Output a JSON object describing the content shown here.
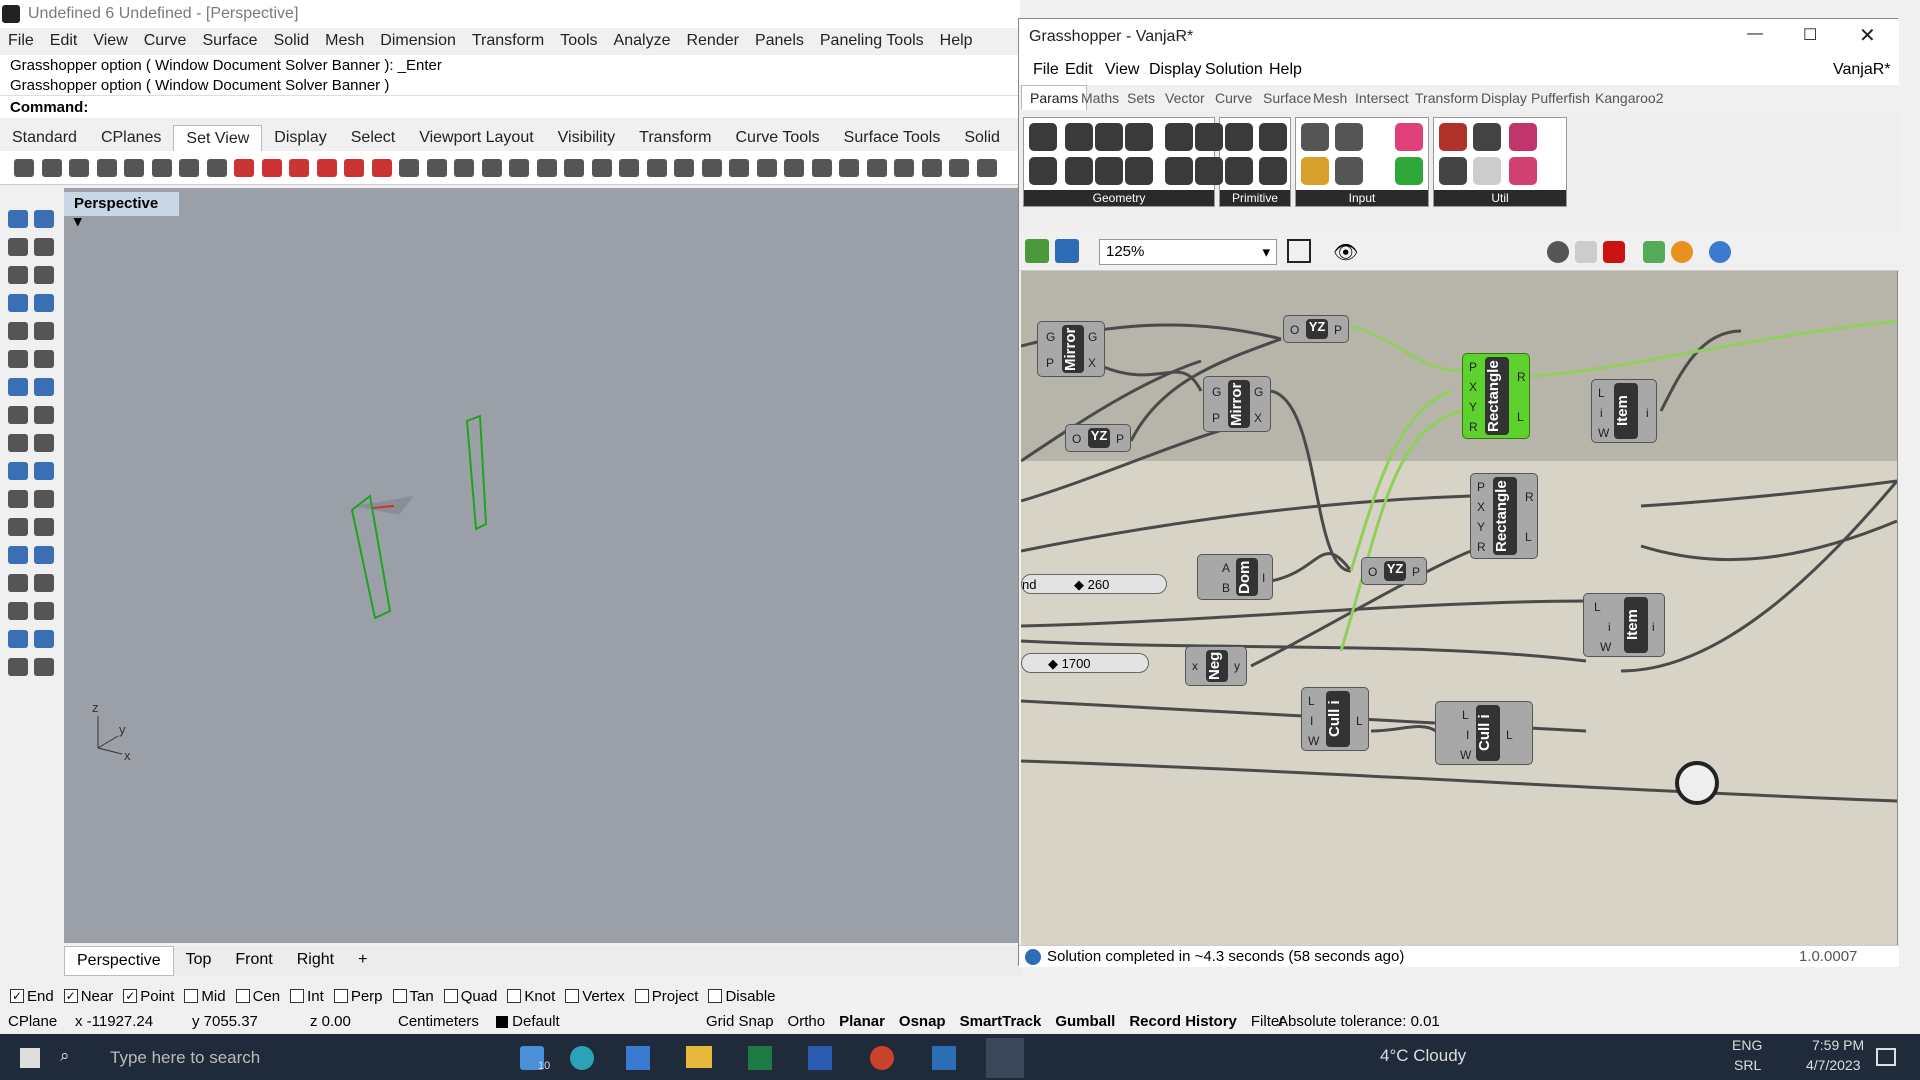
{
  "rhino": {
    "title": "Undefined 6 Undefined - [Perspective]",
    "menu": [
      "File",
      "Edit",
      "View",
      "Curve",
      "Surface",
      "Solid",
      "Mesh",
      "Dimension",
      "Transform",
      "Tools",
      "Analyze",
      "Render",
      "Panels",
      "Paneling Tools",
      "Help"
    ],
    "cmd_history": [
      "Grasshopper option ( Window  Document  Solver  Banner ): _Enter",
      "Grasshopper option ( Window  Document  Solver  Banner )"
    ],
    "command_label": "Command:",
    "tabs": [
      "Standard",
      "CPlanes",
      "Set View",
      "Display",
      "Select",
      "Viewport Layout",
      "Visibility",
      "Transform",
      "Curve Tools",
      "Surface Tools",
      "Solid"
    ],
    "active_tab": "Set View",
    "viewport_label": "Perspective",
    "viewport_tabs": [
      "Perspective",
      "Top",
      "Front",
      "Right"
    ],
    "axes": {
      "z": "z",
      "y": "y",
      "x": "x"
    },
    "osnap": [
      {
        "label": "End",
        "checked": true
      },
      {
        "label": "Near",
        "checked": true
      },
      {
        "label": "Point",
        "checked": true
      },
      {
        "label": "Mid",
        "checked": false
      },
      {
        "label": "Cen",
        "checked": false
      },
      {
        "label": "Int",
        "checked": false
      },
      {
        "label": "Perp",
        "checked": false
      },
      {
        "label": "Tan",
        "checked": false
      },
      {
        "label": "Quad",
        "checked": false
      },
      {
        "label": "Knot",
        "checked": false
      },
      {
        "label": "Vertex",
        "checked": false
      },
      {
        "label": "Project",
        "checked": false
      },
      {
        "label": "Disable",
        "checked": false
      }
    ],
    "status": {
      "cplane": "CPlane",
      "x": "x -11927.24",
      "y": "y 7055.37",
      "z": "z 0.00",
      "units": "Centimeters",
      "layer": "Default",
      "toggles": [
        "Grid Snap",
        "Ortho",
        "Planar",
        "Osnap",
        "SmartTrack",
        "Gumball",
        "Record History",
        "Filter"
      ],
      "tolerance": "Absolute tolerance: 0.01"
    }
  },
  "gh": {
    "title": "Grasshopper - VanjaR*",
    "doc_name": "VanjaR*",
    "menu": [
      "File",
      "Edit",
      "View",
      "Display",
      "Solution",
      "Help"
    ],
    "tabs": [
      "Params",
      "Maths",
      "Sets",
      "Vector",
      "Curve",
      "Surface",
      "Mesh",
      "Intersect",
      "Transform",
      "Display",
      "Pufferfish",
      "Kangaroo2"
    ],
    "ribbon_groups": [
      "Geometry",
      "Primitive",
      "Input",
      "Util"
    ],
    "zoom": "125%",
    "status": "Solution completed in ~4.3 seconds (58 seconds ago)",
    "version": "1.0.0007",
    "nodes": {
      "mirror1": "Mirror",
      "mirror2": "Mirror",
      "yz1": "YZ",
      "yz2": "YZ",
      "yz3": "YZ",
      "rect1": "Rectangle",
      "rect2": "Rectangle",
      "item1": "Item",
      "item2": "Item",
      "dom": "Dom",
      "neg": "Neg",
      "cull1": "Cull i",
      "cull2": "Cull i"
    },
    "sliders": {
      "s1": "260",
      "s2": "1700",
      "s1_prefix": "nd"
    }
  },
  "taskbar": {
    "search": "Type here to search",
    "weather": "4°C  Cloudy",
    "lang1": "ENG",
    "lang2": "SRL",
    "time": "7:59 PM",
    "date": "4/7/2023",
    "mail_badge": "10"
  }
}
